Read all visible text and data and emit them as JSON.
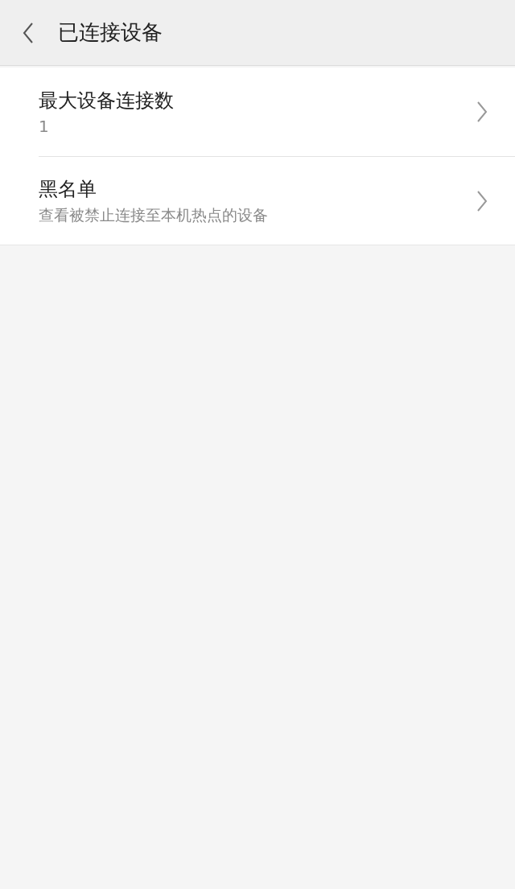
{
  "header": {
    "title": "已连接设备"
  },
  "items": [
    {
      "title": "最大设备连接数",
      "subtitle": "1",
      "kind": "value"
    },
    {
      "title": "黑名单",
      "subtitle": "查看被禁止连接至本机热点的设备",
      "kind": "hint"
    }
  ]
}
